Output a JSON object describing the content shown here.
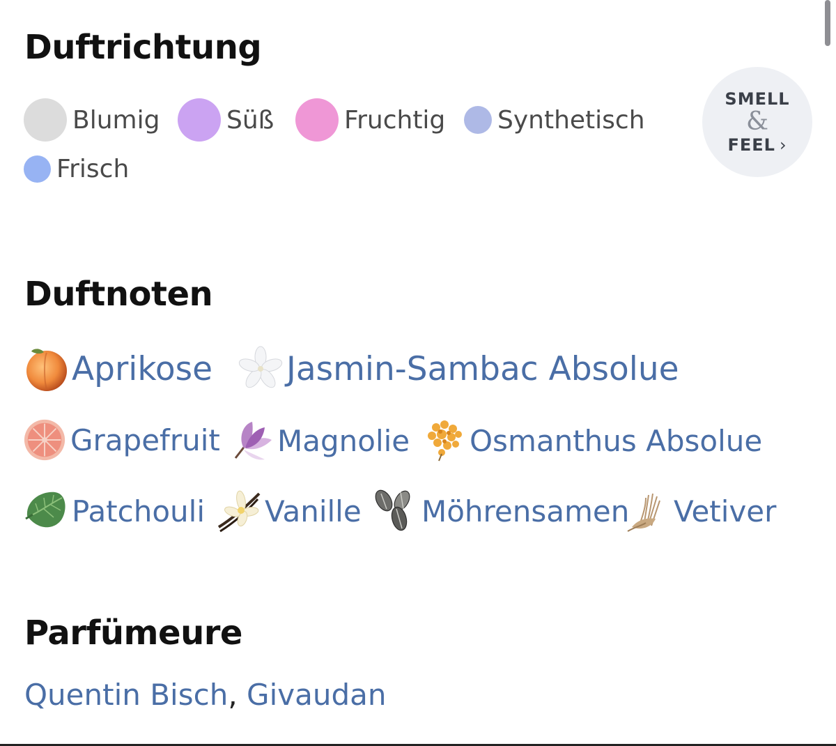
{
  "sections": {
    "accords_title": "Duftrichtung",
    "notes_title": "Duftnoten",
    "perfumers_title": "Parfümeure"
  },
  "accords": [
    {
      "label": "Blumig",
      "color": "#dcdcdc"
    },
    {
      "label": "Süß",
      "color": "#cba3f2"
    },
    {
      "label": "Fruchtig",
      "color": "#ef97d6"
    },
    {
      "label": "Synthetisch",
      "color": "#aeb9e6"
    },
    {
      "label": "Frisch",
      "color": "#97b3f3"
    }
  ],
  "smell_feel": {
    "top": "SMELL",
    "amp": "&",
    "bottom": "FEEL",
    "chevron": "›"
  },
  "notes": [
    {
      "label": "Aprikose",
      "icon": "apricot-icon"
    },
    {
      "label": "Jasmin-Sambac Absolue",
      "icon": "jasmine-icon"
    },
    {
      "label": "Grapefruit",
      "icon": "grapefruit-icon"
    },
    {
      "label": "Magnolie",
      "icon": "magnolia-icon"
    },
    {
      "label": "Osmanthus Absolue",
      "icon": "osmanthus-icon"
    },
    {
      "label": "Patchouli",
      "icon": "patchouli-leaf-icon"
    },
    {
      "label": "Vanille",
      "icon": "vanilla-icon"
    },
    {
      "label": "Möhrensamen",
      "icon": "carrot-seeds-icon"
    },
    {
      "label": "Vetiver",
      "icon": "vetiver-root-icon"
    }
  ],
  "perfumers": {
    "names": [
      "Quentin Bisch",
      "Givaudan"
    ],
    "separator": ","
  },
  "colors": {
    "link": "#4a6ea6",
    "heading": "#111111",
    "muted_text": "#4a4a4a"
  }
}
